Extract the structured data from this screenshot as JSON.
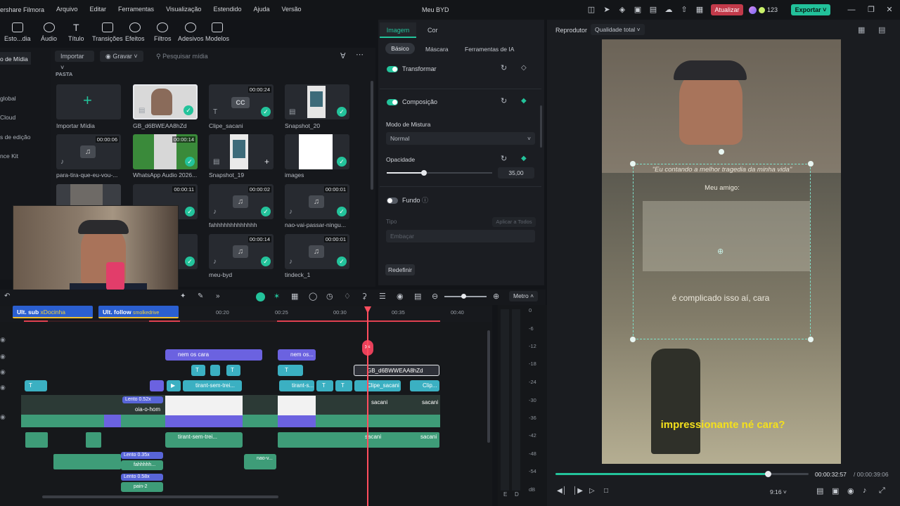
{
  "menubar": {
    "app_title": "ershare Filmora",
    "menus": [
      "Arquivo",
      "Editar",
      "Ferramentas",
      "Visualização",
      "Estendido",
      "Ajuda",
      "Versão"
    ],
    "doc_title": "Meu BYD",
    "update_label": "Atualizar",
    "credits": "123",
    "export_label": "Exportar"
  },
  "toolbar": {
    "tools": [
      "Esto...dia",
      "Áudio",
      "Título",
      "Transições",
      "Efeitos",
      "Filtros",
      "Adesivos",
      "Modelos"
    ]
  },
  "sidebar": {
    "items": [
      "o de Mídia",
      "global",
      "Cloud",
      "s de edição",
      "nce Kit"
    ]
  },
  "media": {
    "import_label": "Importar",
    "record_label": "Gravar",
    "search_placeholder": "Pesquisar mídia",
    "folder_label": "PASTA",
    "items": [
      {
        "label": "Importar Mídia",
        "duration": ""
      },
      {
        "label": "GB_d6BWEAA8hZd",
        "duration": ""
      },
      {
        "label": "Clipe_sacani",
        "duration": "00:00:24"
      },
      {
        "label": "Snapshot_20",
        "duration": ""
      },
      {
        "label": "para-tira-que-eu-vou-...",
        "duration": "00:00:06"
      },
      {
        "label": "WhatsApp Audio 2026...",
        "duration": "00:00:14"
      },
      {
        "label": "Snapshot_19",
        "duration": ""
      },
      {
        "label": "images",
        "duration": ""
      },
      {
        "label": "",
        "duration": ""
      },
      {
        "label": "",
        "duration": "00:00:11"
      },
      {
        "label": "fahhhhhhhhhhhhh",
        "duration": "00:00:02"
      },
      {
        "label": "nao-vai-passar-ningu...",
        "duration": "00:00:01"
      },
      {
        "label": "",
        "duration": ""
      },
      {
        "label": "",
        "duration": ""
      },
      {
        "label": "meu-byd",
        "duration": "00:00:14"
      },
      {
        "label": "tindeck_1",
        "duration": "00:00:01"
      }
    ]
  },
  "inspector": {
    "tabs": [
      "Imagem",
      "Cor"
    ],
    "subtabs": [
      "Básico",
      "Máscara",
      "Ferramentas de IA"
    ],
    "transform_label": "Transformar",
    "composition_label": "Composição",
    "blend_mode_label": "Modo de Mistura",
    "blend_mode_value": "Normal",
    "opacity_label": "Opacidade",
    "opacity_value": "35,00",
    "opacity_fraction": 0.35,
    "background_label": "Fundo",
    "type_label": "Tipo",
    "apply_all_label": "Aplicar a Todos",
    "blur_value": "Embaçar",
    "reset_label": "Redefinir"
  },
  "player": {
    "title": "Reprodutor",
    "quality_label": "Qualidade total",
    "caption_top": "\"Eu contando a melhor tragedia da minha vida\"",
    "caption_friend": "Meu amigo:",
    "caption_mid": "é complicado isso aí, cara",
    "caption_bottom": "impressionante né cara?",
    "current_time": "00:00:32:57",
    "total_time": "/ 00:00:39:06",
    "aspect": "9:16",
    "progress_fraction": 0.84
  },
  "timeline": {
    "ruler": [
      "00:20",
      "00:25",
      "00:30",
      "00:35",
      "00:40"
    ],
    "meter_label": "Metro",
    "meter_scale": [
      "0",
      "-6",
      "-12",
      "-18",
      "-24",
      "-30",
      "-36",
      "-42",
      "-48",
      "-54",
      "dB"
    ],
    "meter_channels": [
      "E",
      "D"
    ],
    "overlay_sub": "Ult. sub",
    "overlay_sub_user": "xDocinha",
    "overlay_follow": "Ult. follow",
    "overlay_follow_user": "smolkedrive",
    "clips": {
      "title_1": "nem os cara",
      "title_2": "nem os...",
      "selected_clip": "GB_d6BWWEAA8hZd",
      "clip_tirant": "tirant-sem-trei...",
      "clip_tirant_short": "tirant-s...",
      "clip_sacani": "Clipe_sacani",
      "clip_clip": "Clip...",
      "clip_oia": "oia-o-hom",
      "clip_sacani_short": "sacani",
      "speed_1": "Lento 0.52x",
      "speed_2": "Lento 0.35x",
      "speed_3": "Lento 0.58x",
      "audio_fahh": "fahhhhh...",
      "audio_pain": "pain-2",
      "audio_tirant": "tirant-sem-trei...",
      "audio_sacani": "sacani",
      "audio_nao": "nao-v..."
    }
  }
}
